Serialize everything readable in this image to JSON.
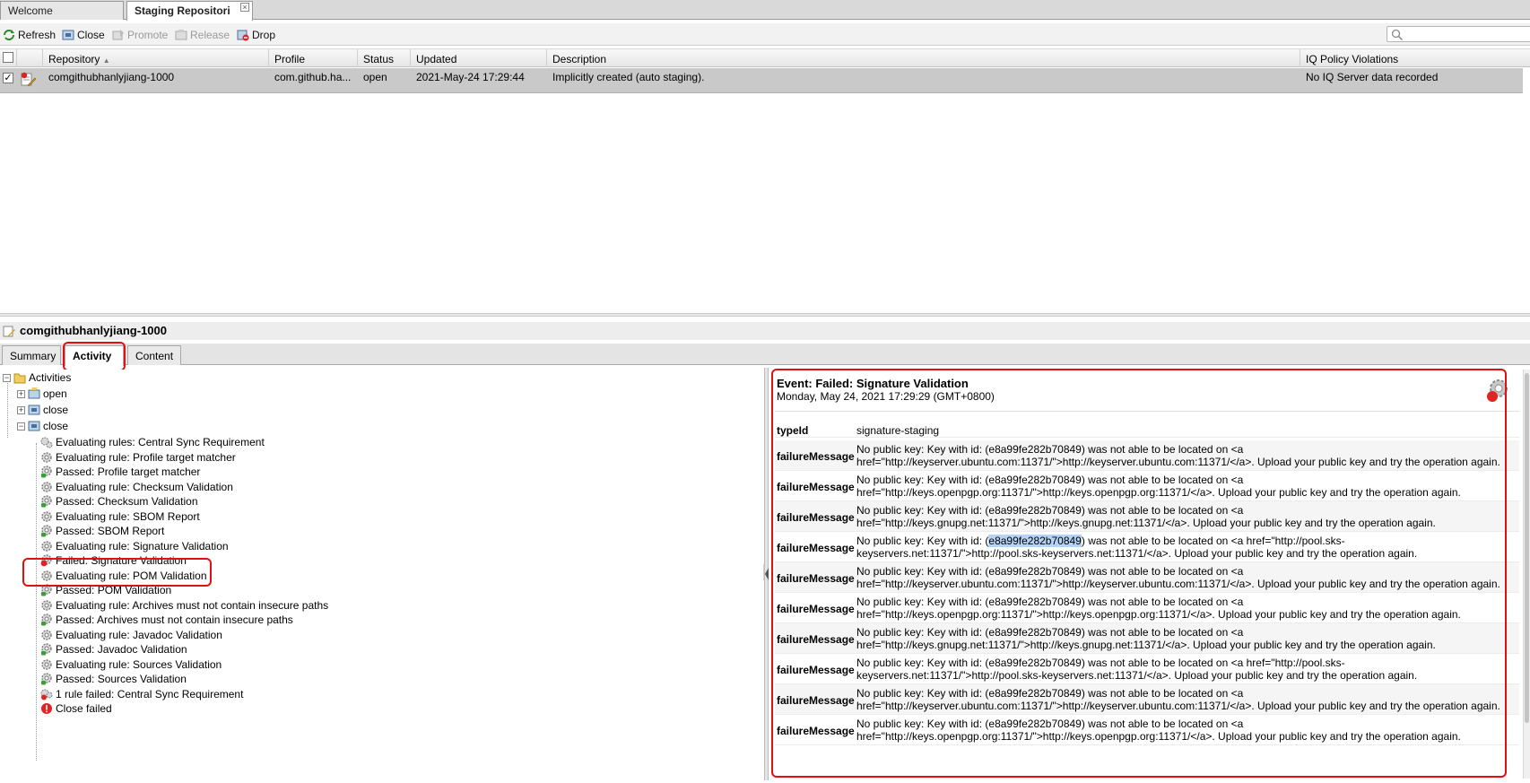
{
  "tabs": [
    {
      "label": "Welcome",
      "active": false
    },
    {
      "label": "Staging Repositori",
      "active": true,
      "close": "×"
    }
  ],
  "toolbar": {
    "refresh": "Refresh",
    "close": "Close",
    "promote": "Promote",
    "release": "Release",
    "drop": "Drop"
  },
  "grid": {
    "columns": [
      "Repository",
      "Profile",
      "Status",
      "Updated",
      "Description",
      "IQ Policy Violations"
    ],
    "sort_indicator": "▲",
    "rows": [
      {
        "checked": "✓",
        "repository": "comgithubhanlyjiang-1000",
        "profile": "com.github.ha...",
        "status": "open",
        "updated": "2021-May-24 17:29:44",
        "description": "Implicitly created (auto staging).",
        "iq": "No IQ Server data recorded"
      }
    ]
  },
  "detail": {
    "title": "comgithubhanlyjiang-1000",
    "tabs": [
      "Summary",
      "Activity",
      "Content"
    ],
    "active_tab": "Activity"
  },
  "tree": {
    "root": "Activities",
    "groups": [
      {
        "label": "open",
        "expander": "+"
      },
      {
        "label": "close",
        "expander": "+"
      },
      {
        "label": "close",
        "expander": "−"
      }
    ],
    "items": [
      {
        "label": "Evaluating rules: Central Sync Requirement",
        "icon": "gears-icon"
      },
      {
        "label": "Evaluating rule: Profile target matcher",
        "icon": "gear-icon"
      },
      {
        "label": "Passed: Profile target matcher",
        "icon": "gear-pass-icon"
      },
      {
        "label": "Evaluating rule: Checksum Validation",
        "icon": "gear-icon"
      },
      {
        "label": "Passed: Checksum Validation",
        "icon": "gear-pass-icon"
      },
      {
        "label": "Evaluating rule: SBOM Report",
        "icon": "gear-icon"
      },
      {
        "label": "Passed: SBOM Report",
        "icon": "gear-pass-icon"
      },
      {
        "label": "Evaluating rule: Signature Validation",
        "icon": "gear-icon"
      },
      {
        "label": "Failed: Signature Validation",
        "icon": "gear-fail-icon"
      },
      {
        "label": "Evaluating rule: POM Validation",
        "icon": "gear-icon"
      },
      {
        "label": "Passed: POM Validation",
        "icon": "gear-pass-icon"
      },
      {
        "label": "Evaluating rule: Archives must not contain insecure paths",
        "icon": "gear-icon"
      },
      {
        "label": "Passed: Archives must not contain insecure paths",
        "icon": "gear-pass-icon"
      },
      {
        "label": "Evaluating rule: Javadoc Validation",
        "icon": "gear-icon"
      },
      {
        "label": "Passed: Javadoc Validation",
        "icon": "gear-pass-icon"
      },
      {
        "label": "Evaluating rule: Sources Validation",
        "icon": "gear-icon"
      },
      {
        "label": "Passed: Sources Validation",
        "icon": "gear-pass-icon"
      },
      {
        "label": "1 rule failed: Central Sync Requirement",
        "icon": "gears-fail-icon"
      },
      {
        "label": "Close failed",
        "icon": "error-icon"
      }
    ]
  },
  "event": {
    "title": "Event: Failed: Signature Validation",
    "date": "Monday, May 24, 2021 17:29:29 (GMT+0800)",
    "type_key": "typeId",
    "type_value": "signature-staging",
    "message_key": "failureMessage",
    "messages": [
      {
        "l1": "No public key: Key with id: (e8a99fe282b70849) was not able to be located on <a",
        "l2": "href=\"http://keyserver.ubuntu.com:11371/\">http://keyserver.ubuntu.com:11371/</a>. Upload your public key and try the operation again."
      },
      {
        "l1": "No public key: Key with id: (e8a99fe282b70849) was not able to be located on <a",
        "l2": "href=\"http://keys.openpgp.org:11371/\">http://keys.openpgp.org:11371/</a>. Upload your public key and try the operation again."
      },
      {
        "l1": "No public key: Key with id: (e8a99fe282b70849) was not able to be located on <a",
        "l2": "href=\"http://keys.gnupg.net:11371/\">http://keys.gnupg.net:11371/</a>. Upload your public key and try the operation again."
      },
      {
        "l1a": "No public key: Key with id: (",
        "l1hl": "e8a99fe282b70849",
        "l1b": ") was not able to be located on <a href=\"http://pool.sks-",
        "l2": "keyservers.net:11371/\">http://pool.sks-keyservers.net:11371/</a>. Upload your public key and try the operation again."
      },
      {
        "l1": "No public key: Key with id: (e8a99fe282b70849) was not able to be located on <a",
        "l2": "href=\"http://keyserver.ubuntu.com:11371/\">http://keyserver.ubuntu.com:11371/</a>. Upload your public key and try the operation again."
      },
      {
        "l1": "No public key: Key with id: (e8a99fe282b70849) was not able to be located on <a",
        "l2": "href=\"http://keys.openpgp.org:11371/\">http://keys.openpgp.org:11371/</a>. Upload your public key and try the operation again."
      },
      {
        "l1": "No public key: Key with id: (e8a99fe282b70849) was not able to be located on <a",
        "l2": "href=\"http://keys.gnupg.net:11371/\">http://keys.gnupg.net:11371/</a>. Upload your public key and try the operation again."
      },
      {
        "l1": "No public key: Key with id: (e8a99fe282b70849) was not able to be located on <a href=\"http://pool.sks-",
        "l2": "keyservers.net:11371/\">http://pool.sks-keyservers.net:11371/</a>. Upload your public key and try the operation again."
      },
      {
        "l1": "No public key: Key with id: (e8a99fe282b70849) was not able to be located on <a",
        "l2": "href=\"http://keyserver.ubuntu.com:11371/\">http://keyserver.ubuntu.com:11371/</a>. Upload your public key and try the operation again."
      },
      {
        "l1": "No public key: Key with id: (e8a99fe282b70849) was not able to be located on <a",
        "l2": "href=\"http://keys.openpgp.org:11371/\">http://keys.openpgp.org:11371/</a>. Upload your public key and try the operation again."
      }
    ]
  },
  "colors": {
    "annotation_red": "#e01010",
    "selected_row": "#c9c9c9",
    "highlight": "#b5d3f5"
  }
}
